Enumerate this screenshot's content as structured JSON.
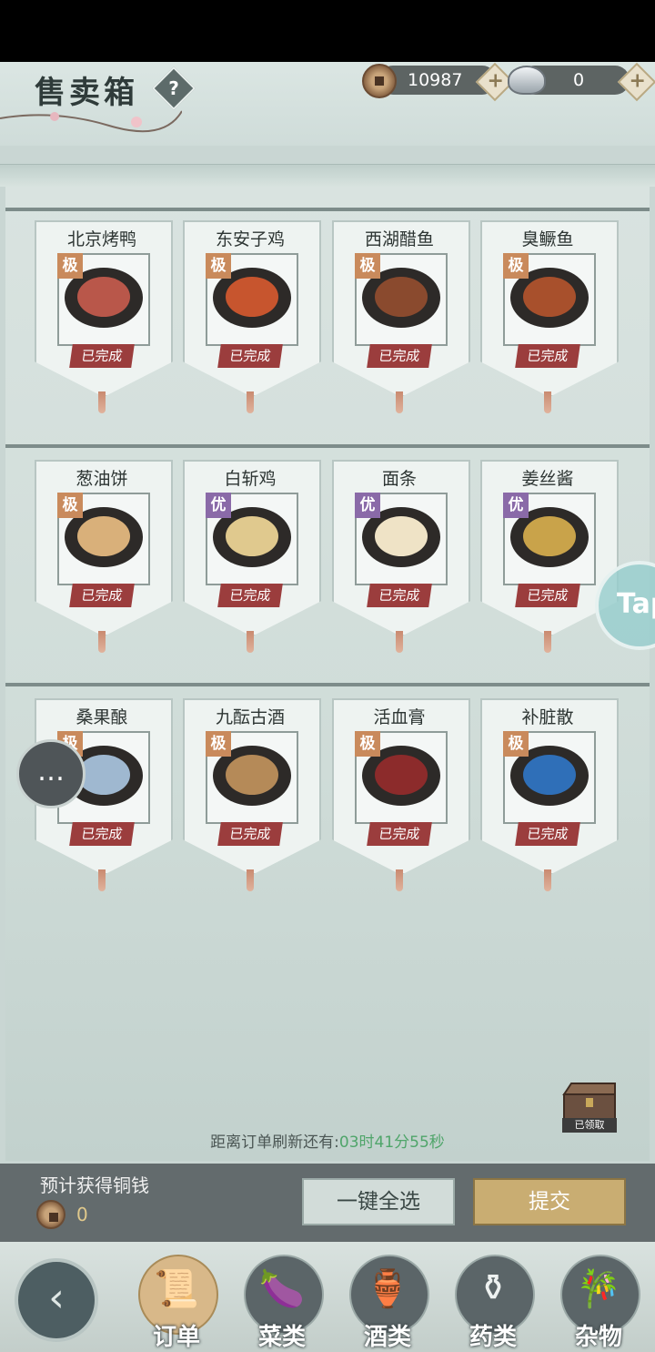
{
  "header": {
    "title": "售卖箱",
    "help_label": "?",
    "copper_amount": "10987",
    "silver_amount": "0",
    "plus_label": "+"
  },
  "rows": [
    [
      {
        "name": "北京烤鸭",
        "grade": "极",
        "grade_color": "#c98a5c",
        "status": "已完成",
        "food_color": "#b9574a"
      },
      {
        "name": "东安子鸡",
        "grade": "极",
        "grade_color": "#c98a5c",
        "status": "已完成",
        "food_color": "#c7552e"
      },
      {
        "name": "西湖醋鱼",
        "grade": "极",
        "grade_color": "#c98a5c",
        "status": "已完成",
        "food_color": "#8a4a2e"
      },
      {
        "name": "臭鳜鱼",
        "grade": "极",
        "grade_color": "#c98a5c",
        "status": "已完成",
        "food_color": "#a8502c"
      }
    ],
    [
      {
        "name": "葱油饼",
        "grade": "极",
        "grade_color": "#c98a5c",
        "status": "已完成",
        "food_color": "#d9b07a"
      },
      {
        "name": "白斩鸡",
        "grade": "优",
        "grade_color": "#8a6aa8",
        "status": "已完成",
        "food_color": "#e0c98e"
      },
      {
        "name": "面条",
        "grade": "优",
        "grade_color": "#8a6aa8",
        "status": "已完成",
        "food_color": "#efe3c6"
      },
      {
        "name": "姜丝酱",
        "grade": "优",
        "grade_color": "#8a6aa8",
        "status": "已完成",
        "food_color": "#c9a34a"
      }
    ],
    [
      {
        "name": "桑果酿",
        "grade": "极",
        "grade_color": "#c98a5c",
        "status": "已完成",
        "food_color": "#9fb8d0"
      },
      {
        "name": "九酝古酒",
        "grade": "极",
        "grade_color": "#c98a5c",
        "status": "已完成",
        "food_color": "#b58a58"
      },
      {
        "name": "活血膏",
        "grade": "极",
        "grade_color": "#c98a5c",
        "status": "已完成",
        "food_color": "#8c2b2b"
      },
      {
        "name": "补脏散",
        "grade": "极",
        "grade_color": "#c98a5c",
        "status": "已完成",
        "food_color": "#2f6fb8"
      }
    ]
  ],
  "refresh": {
    "label": "距离订单刷新还有:",
    "time": "03时41分55秒"
  },
  "chest": {
    "label": "已领取"
  },
  "estimate": {
    "label": "预计获得铜钱",
    "value": "0"
  },
  "buttons": {
    "select_all": "一键全选",
    "submit": "提交"
  },
  "tabs": [
    {
      "label": "订单",
      "icon": "scroll-icon",
      "glyph": "📜"
    },
    {
      "label": "菜类",
      "icon": "eggplant-icon",
      "glyph": "🍆"
    },
    {
      "label": "酒类",
      "icon": "wine-jar-icon",
      "glyph": "🏺"
    },
    {
      "label": "药类",
      "icon": "mortar-icon",
      "glyph": "⚱"
    },
    {
      "label": "杂物",
      "icon": "bundle-icon",
      "glyph": "🎋"
    }
  ],
  "back_glyph": "‹",
  "chat_glyph": "…",
  "tap_label": "Tap"
}
